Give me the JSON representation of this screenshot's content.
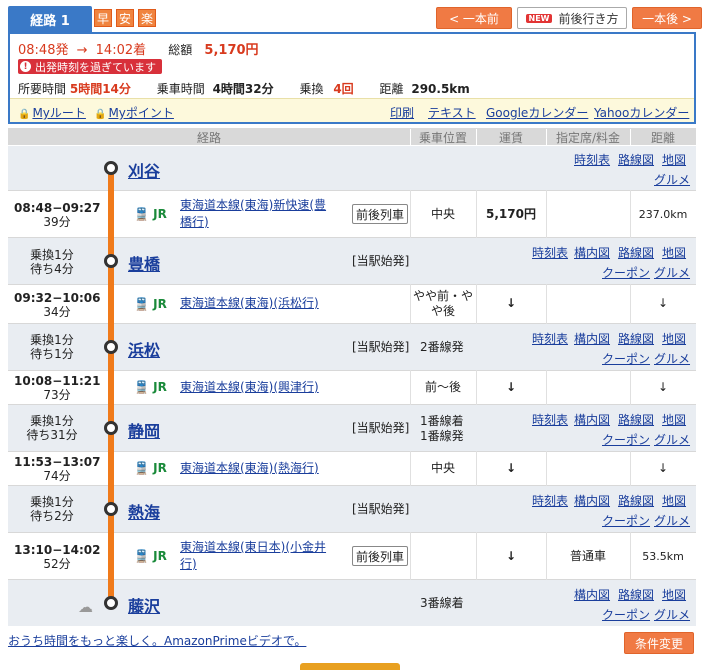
{
  "header": {
    "route_label": "経路 1",
    "badges": [
      "早",
      "安",
      "楽"
    ],
    "prev_button": "< 一本前",
    "new_badge": "NEW",
    "around_button": "前後行き方",
    "next_button": "一本後 >"
  },
  "summary": {
    "dep": "08:48発",
    "arrow": "→",
    "arr": "14:02着",
    "total_label": "総額",
    "total_value": "5,170円",
    "warning": "出発時刻を過ぎています",
    "warning_icon": "!",
    "required_label": "所要時間",
    "required_value": "5時間14分",
    "ride_label": "乗車時間",
    "ride_value": "4時間32分",
    "transfer_label": "乗換",
    "transfer_value": "4回",
    "distance_label": "距離",
    "distance_value": "290.5km",
    "my_route": "Myルート",
    "my_point": "Myポイント",
    "print": "印刷",
    "text": "テキスト",
    "google_cal": "Googleカレンダー",
    "yahoo_cal": "Yahooカレンダー"
  },
  "table_header": {
    "route": "経路",
    "position": "乗車位置",
    "fare": "運賃",
    "seat": "指定席/料金",
    "distance": "距離"
  },
  "stations": [
    {
      "name": "刈谷",
      "links": [
        "時刻表",
        "路線図",
        "地図",
        "グルメ"
      ],
      "time1": "",
      "time2": "",
      "start": "",
      "platform": ""
    },
    {
      "name": "豊橋",
      "links": [
        "時刻表",
        "構内図",
        "路線図",
        "地図",
        "クーポン",
        "グルメ"
      ],
      "time1": "乗換1分",
      "time2": "待ち4分",
      "start": "[当駅始発]",
      "platform": ""
    },
    {
      "name": "浜松",
      "links": [
        "時刻表",
        "構内図",
        "路線図",
        "地図",
        "クーポン",
        "グルメ"
      ],
      "time1": "乗換1分",
      "time2": "待ち1分",
      "start": "[当駅始発]",
      "platform": "2番線発"
    },
    {
      "name": "静岡",
      "links": [
        "時刻表",
        "構内図",
        "路線図",
        "地図",
        "クーポン",
        "グルメ"
      ],
      "time1": "乗換1分",
      "time2": "待ち31分",
      "start": "[当駅始発]",
      "platform": "1番線着",
      "platform2": "1番線発"
    },
    {
      "name": "熱海",
      "links": [
        "時刻表",
        "構内図",
        "路線図",
        "地図",
        "クーポン",
        "グルメ"
      ],
      "time1": "乗換1分",
      "time2": "待ち2分",
      "start": "[当駅始発]",
      "platform": ""
    },
    {
      "name": "藤沢",
      "links": [
        "構内図",
        "路線図",
        "地図",
        "クーポン",
        "グルメ"
      ],
      "time1": "",
      "time2": "",
      "start": "",
      "platform": "3番線着"
    }
  ],
  "segments": [
    {
      "time": "08:48−09:27",
      "dur": "39分",
      "jr": "JR",
      "line1": "東海道本線(東海)新快速(豊",
      "line2": "橋行)",
      "zenkou": "前後列車",
      "pos1": "中央",
      "pos2": "",
      "fare": "5,170円",
      "seat": "",
      "dist": "237.0km"
    },
    {
      "time": "09:32−10:06",
      "dur": "34分",
      "jr": "JR",
      "line1": "東海道本線(東海)(浜松行)",
      "line2": "",
      "zenkou": "",
      "pos1": "やや前・や",
      "pos2": "や後",
      "fare": "↓",
      "seat": "",
      "dist": "↓"
    },
    {
      "time": "10:08−11:21",
      "dur": "73分",
      "jr": "JR",
      "line1": "東海道本線(東海)(興津行)",
      "line2": "",
      "zenkou": "",
      "pos1": "前〜後",
      "pos2": "",
      "fare": "↓",
      "seat": "",
      "dist": "↓"
    },
    {
      "time": "11:53−13:07",
      "dur": "74分",
      "jr": "JR",
      "line1": "東海道本線(東海)(熱海行)",
      "line2": "",
      "zenkou": "",
      "pos1": "中央",
      "pos2": "",
      "fare": "↓",
      "seat": "",
      "dist": "↓"
    },
    {
      "time": "13:10−14:02",
      "dur": "52分",
      "jr": "JR",
      "line1": "東海道本線(東日本)(小金井",
      "line2": "行)",
      "zenkou": "前後列車",
      "pos1": "",
      "pos2": "",
      "fare": "↓",
      "seat": "普通車",
      "dist": "53.5km"
    }
  ],
  "footer": {
    "ad_link": "おうち時間をもっと楽しく。AmazonPrimeビデオで。",
    "condition_button": "条件変更"
  }
}
